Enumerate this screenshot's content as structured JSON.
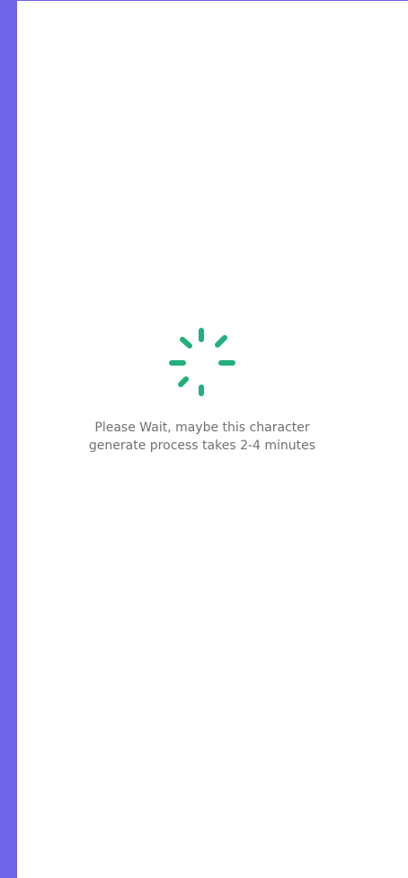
{
  "theme": {
    "accent": "#6f63e6",
    "spinner": "#22b07a",
    "text": "#707070",
    "background": "#ffffff"
  },
  "loading": {
    "icon": "spinner-icon",
    "message_line1": "Please Wait, maybe this character",
    "message_line2": "generate process takes 2-4 minutes"
  }
}
